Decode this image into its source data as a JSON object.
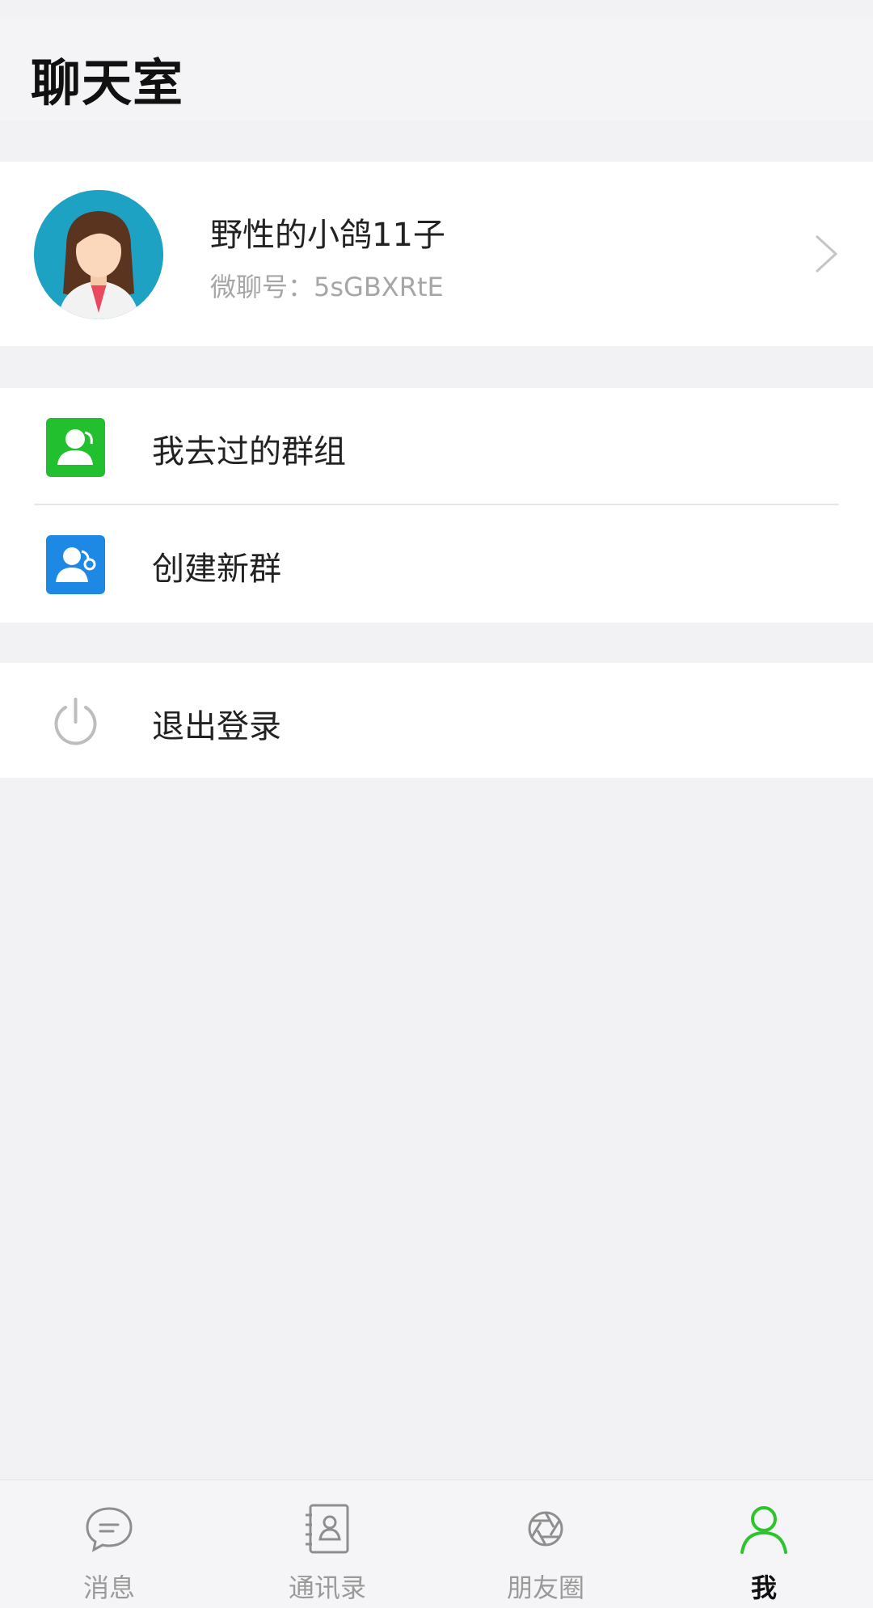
{
  "header": {
    "title": "聊天室"
  },
  "profile": {
    "name": "野性的小鸽11子",
    "account_label": "微聊号：",
    "account_id": "5sGBXRtE"
  },
  "menu": {
    "groups_visited": "我去过的群组",
    "create_group": "创建新群",
    "logout": "退出登录"
  },
  "tabbar": {
    "tabs": [
      {
        "label": "消息",
        "icon": "chat-bubble-icon",
        "active": false
      },
      {
        "label": "通讯录",
        "icon": "contacts-book-icon",
        "active": false
      },
      {
        "label": "朋友圈",
        "icon": "camera-shutter-icon",
        "active": false
      },
      {
        "label": "我",
        "icon": "person-icon",
        "active": true
      }
    ]
  },
  "colors": {
    "accent_green": "#2dc52d",
    "create_blue": "#1e88e5",
    "avatar_bg": "#1ea2c4"
  }
}
